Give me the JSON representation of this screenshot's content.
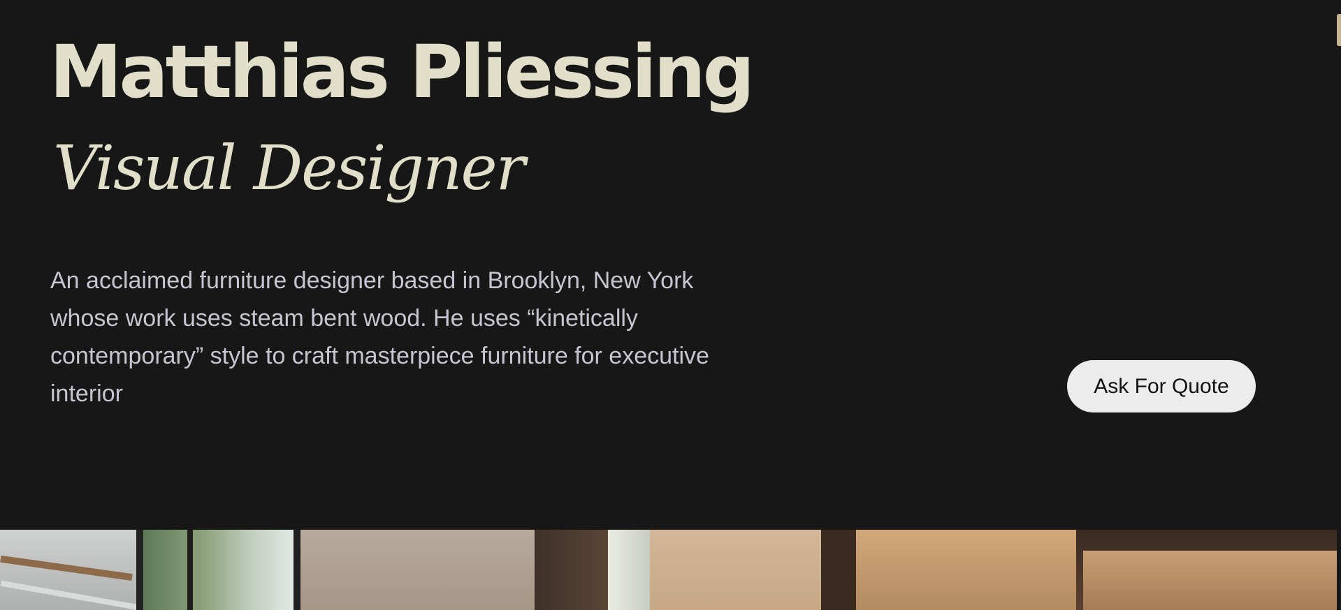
{
  "hero": {
    "name": "Matthias Pliessing",
    "role": "Visual Designer",
    "bio": "An acclaimed furniture designer based in Brooklyn, New York whose work uses steam bent wood. He uses “kinetically contemporary” style to craft masterpiece furniture for executive interior",
    "cta_label": "Ask For Quote"
  },
  "colors": {
    "background": "#171717",
    "heading": "#e1dfc9",
    "body_text": "#c8c5d1",
    "button_bg": "#ececec",
    "scroll_accent": "#c8b593"
  }
}
